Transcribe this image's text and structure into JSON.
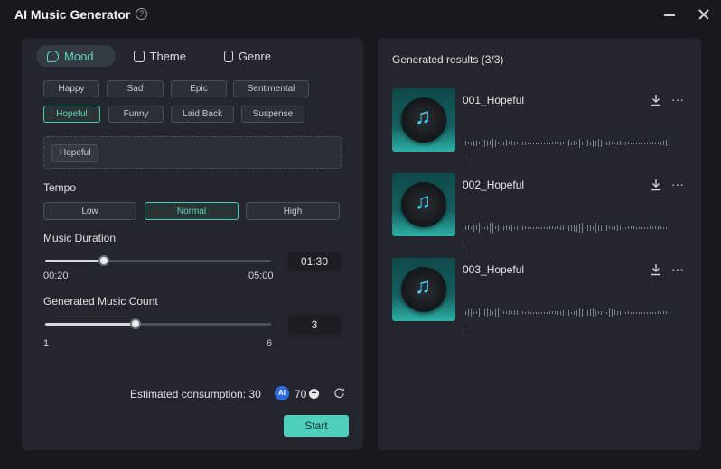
{
  "app": {
    "title": "AI Music Generator"
  },
  "tabs": [
    {
      "label": "Mood",
      "active": true
    },
    {
      "label": "Theme"
    },
    {
      "label": "Genre"
    }
  ],
  "moods": [
    "Happy",
    "Sad",
    "Epic",
    "Sentimental",
    "Hopeful",
    "Funny",
    "Laid Back",
    "Suspense"
  ],
  "selected_mood": "Hopeful",
  "selected_box": {
    "tag": "Hopeful"
  },
  "tempo": {
    "label": "Tempo",
    "options": [
      "Low",
      "Normal",
      "High"
    ],
    "selected": "Normal"
  },
  "duration": {
    "label": "Music Duration",
    "min": "00:20",
    "max": "05:00",
    "value": "01:30",
    "level": 0.26
  },
  "count": {
    "label": "Generated Music Count",
    "min": "1",
    "max": "6",
    "value": "3",
    "level": 0.4
  },
  "footer": {
    "consumption_label": "Estimated consumption: 30",
    "credits": "70",
    "start_label": "Start"
  },
  "results": {
    "title": "Generated results (3/3)",
    "items": [
      {
        "name": "001_Hopeful"
      },
      {
        "name": "002_Hopeful"
      },
      {
        "name": "003_Hopeful"
      }
    ]
  },
  "colors": {
    "accent": "#4fd0bc",
    "background": "#17191e",
    "panel": "#23272d"
  },
  "icons": [
    "help-icon",
    "minimize-icon",
    "close-icon",
    "mood-icon",
    "theme-icon",
    "genre-icon",
    "ai-credit-icon",
    "plus-icon",
    "refresh-icon",
    "music-note-icon",
    "download-icon",
    "more-icon"
  ]
}
